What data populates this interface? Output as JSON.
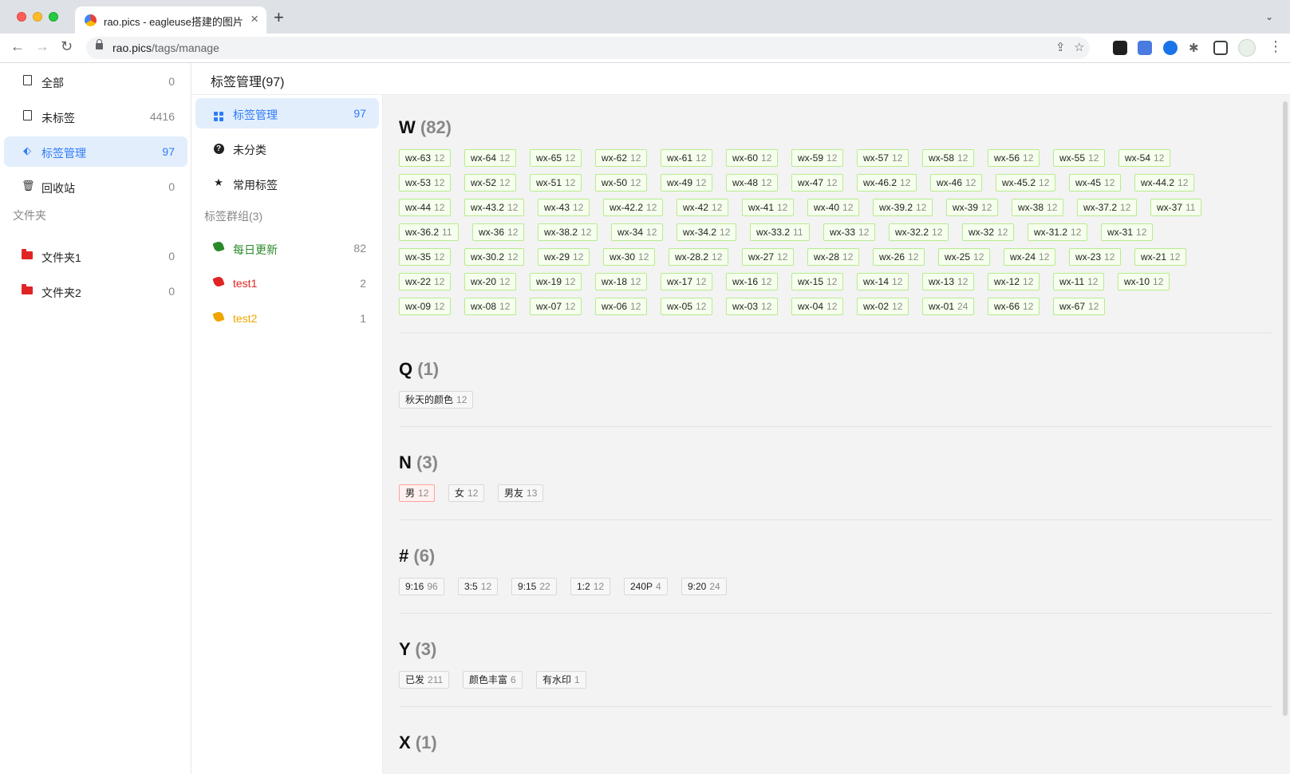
{
  "browser": {
    "tab_title": "rao.pics - eagleuse搭建的图片管理",
    "url_host": "rao.pics",
    "url_path": "/tags/manage"
  },
  "sidebar": {
    "items": [
      {
        "label": "全部",
        "count": "0",
        "icon": "file-icon"
      },
      {
        "label": "未标签",
        "count": "4416",
        "icon": "file-icon"
      },
      {
        "label": "标签管理",
        "count": "97",
        "icon": "tag-icon"
      },
      {
        "label": "回收站",
        "count": "0",
        "icon": "trash-icon"
      }
    ],
    "folder_heading": "文件夹",
    "folders": [
      {
        "label": "文件夹1",
        "count": "0"
      },
      {
        "label": "文件夹2",
        "count": "0"
      }
    ]
  },
  "header": {
    "title": "标签管理(97)"
  },
  "subnav": {
    "items": [
      {
        "label": "标签管理",
        "count": "97"
      },
      {
        "label": "未分类",
        "count": ""
      },
      {
        "label": "常用标签",
        "count": ""
      }
    ],
    "group_heading": "标签群组(3)",
    "groups": [
      {
        "label": "每日更新",
        "count": "82",
        "color": "#2a8a2a"
      },
      {
        "label": "test1",
        "count": "2",
        "color": "#e02424"
      },
      {
        "label": "test2",
        "count": "1",
        "color": "#f0a500"
      }
    ]
  },
  "tag_groups": [
    {
      "letter": "W",
      "count": "(82)",
      "style": "green",
      "rows": [
        [
          [
            "wx-63",
            "12"
          ],
          [
            "wx-64",
            "12"
          ],
          [
            "wx-65",
            "12"
          ],
          [
            "wx-62",
            "12"
          ],
          [
            "wx-61",
            "12"
          ],
          [
            "wx-60",
            "12"
          ],
          [
            "wx-59",
            "12"
          ],
          [
            "wx-57",
            "12"
          ],
          [
            "wx-58",
            "12"
          ],
          [
            "wx-56",
            "12"
          ],
          [
            "wx-55",
            "12"
          ],
          [
            "wx-54",
            "12"
          ]
        ],
        [
          [
            "wx-53",
            "12"
          ],
          [
            "wx-52",
            "12"
          ],
          [
            "wx-51",
            "12"
          ],
          [
            "wx-50",
            "12"
          ],
          [
            "wx-49",
            "12"
          ],
          [
            "wx-48",
            "12"
          ],
          [
            "wx-47",
            "12"
          ],
          [
            "wx-46.2",
            "12"
          ],
          [
            "wx-46",
            "12"
          ],
          [
            "wx-45.2",
            "12"
          ],
          [
            "wx-45",
            "12"
          ],
          [
            "wx-44.2",
            "12"
          ]
        ],
        [
          [
            "wx-44",
            "12"
          ],
          [
            "wx-43.2",
            "12"
          ],
          [
            "wx-43",
            "12"
          ],
          [
            "wx-42.2",
            "12"
          ],
          [
            "wx-42",
            "12"
          ],
          [
            "wx-41",
            "12"
          ],
          [
            "wx-40",
            "12"
          ],
          [
            "wx-39.2",
            "12"
          ],
          [
            "wx-39",
            "12"
          ],
          [
            "wx-38",
            "12"
          ],
          [
            "wx-37.2",
            "12"
          ],
          [
            "wx-37",
            "11"
          ]
        ],
        [
          [
            "wx-36.2",
            "11"
          ],
          [
            "wx-36",
            "12"
          ],
          [
            "wx-38.2",
            "12"
          ],
          [
            "wx-34",
            "12"
          ],
          [
            "wx-34.2",
            "12"
          ],
          [
            "wx-33.2",
            "11"
          ],
          [
            "wx-33",
            "12"
          ],
          [
            "wx-32.2",
            "12"
          ],
          [
            "wx-32",
            "12"
          ],
          [
            "wx-31.2",
            "12"
          ],
          [
            "wx-31",
            "12"
          ]
        ],
        [
          [
            "wx-35",
            "12"
          ],
          [
            "wx-30.2",
            "12"
          ],
          [
            "wx-29",
            "12"
          ],
          [
            "wx-30",
            "12"
          ],
          [
            "wx-28.2",
            "12"
          ],
          [
            "wx-27",
            "12"
          ],
          [
            "wx-28",
            "12"
          ],
          [
            "wx-26",
            "12"
          ],
          [
            "wx-25",
            "12"
          ],
          [
            "wx-24",
            "12"
          ],
          [
            "wx-23",
            "12"
          ],
          [
            "wx-21",
            "12"
          ]
        ],
        [
          [
            "wx-22",
            "12"
          ],
          [
            "wx-20",
            "12"
          ],
          [
            "wx-19",
            "12"
          ],
          [
            "wx-18",
            "12"
          ],
          [
            "wx-17",
            "12"
          ],
          [
            "wx-16",
            "12"
          ],
          [
            "wx-15",
            "12"
          ],
          [
            "wx-14",
            "12"
          ],
          [
            "wx-13",
            "12"
          ],
          [
            "wx-12",
            "12"
          ],
          [
            "wx-11",
            "12"
          ],
          [
            "wx-10",
            "12"
          ]
        ],
        [
          [
            "wx-09",
            "12"
          ],
          [
            "wx-08",
            "12"
          ],
          [
            "wx-07",
            "12"
          ],
          [
            "wx-06",
            "12"
          ],
          [
            "wx-05",
            "12"
          ],
          [
            "wx-03",
            "12"
          ],
          [
            "wx-04",
            "12"
          ],
          [
            "wx-02",
            "12"
          ],
          [
            "wx-01",
            "24"
          ],
          [
            "wx-66",
            "12"
          ],
          [
            "wx-67",
            "12"
          ]
        ]
      ]
    },
    {
      "letter": "Q",
      "count": "(1)",
      "style": "gray",
      "rows": [
        [
          [
            "秋天的颜色",
            "12"
          ]
        ]
      ]
    },
    {
      "letter": "N",
      "count": "(3)",
      "style": "gray",
      "rows": [
        [
          [
            "男",
            "12",
            "red"
          ],
          [
            "女",
            "12"
          ],
          [
            "男友",
            "13"
          ]
        ]
      ]
    },
    {
      "letter": "#",
      "count": "(6)",
      "style": "gray",
      "rows": [
        [
          [
            "9:16",
            "96"
          ],
          [
            "3:5",
            "12"
          ],
          [
            "9:15",
            "22"
          ],
          [
            "1:2",
            "12"
          ],
          [
            "240P",
            "4"
          ],
          [
            "9:20",
            "24"
          ]
        ]
      ]
    },
    {
      "letter": "Y",
      "count": "(3)",
      "style": "gray",
      "rows": [
        [
          [
            "已发",
            "211"
          ],
          [
            "颜色丰富",
            "6"
          ],
          [
            "有水印",
            "1"
          ]
        ]
      ]
    },
    {
      "letter": "X",
      "count": "(1)",
      "style": "gray",
      "rows": []
    }
  ]
}
